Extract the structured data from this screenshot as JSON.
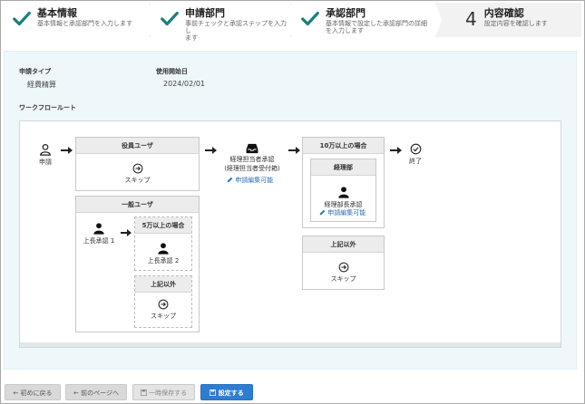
{
  "steps": [
    {
      "title": "基本情報",
      "desc": "基本情報と承認部門を入力します"
    },
    {
      "title": "申請部門",
      "desc1": "事前チェックと承認ステップを入力し",
      "desc2": "ます"
    },
    {
      "title": "承認部門",
      "desc1": "基本情報で設定した承認部門の詳細",
      "desc2": "を入力します"
    },
    {
      "num": "4",
      "title": "内容確認",
      "desc": "設定内容を確認します"
    }
  ],
  "info": {
    "type_label": "申請タイプ",
    "type_value": "経費精算",
    "date_label": "使用開始日",
    "date_value": "2024/02/01",
    "workflow_label": "ワークフロールート"
  },
  "flow": {
    "start": "申請",
    "officer_box": {
      "title": "役員ユーザ",
      "skip": "スキップ"
    },
    "general_box": {
      "title": "一般ユーザ",
      "approver1": "上長承認 1",
      "over_box": {
        "title": "5万以上の場合",
        "approver": "上長承認 2"
      },
      "else_box": {
        "title": "上記以外",
        "skip": "スキップ"
      }
    },
    "accounting": {
      "line1": "経理担当者承認",
      "line2": "(経理担当者受付箱)",
      "edit": "申請編集可能"
    },
    "big_box": {
      "title": "10万以上の場合",
      "dept_box": {
        "title": "経理部",
        "approver": "経理部長承認",
        "edit": "申請編集可能"
      }
    },
    "else_box2": {
      "title": "上記以外",
      "skip": "スキップ"
    },
    "end": "終了"
  },
  "buttons": {
    "first": "初めに戻る",
    "prev": "前のページへ",
    "save": "一時保存する",
    "submit": "設定する"
  },
  "colors": {
    "accent": "#2e7dd1",
    "check": "#1a7f7a",
    "panel": "#eef8fb"
  }
}
